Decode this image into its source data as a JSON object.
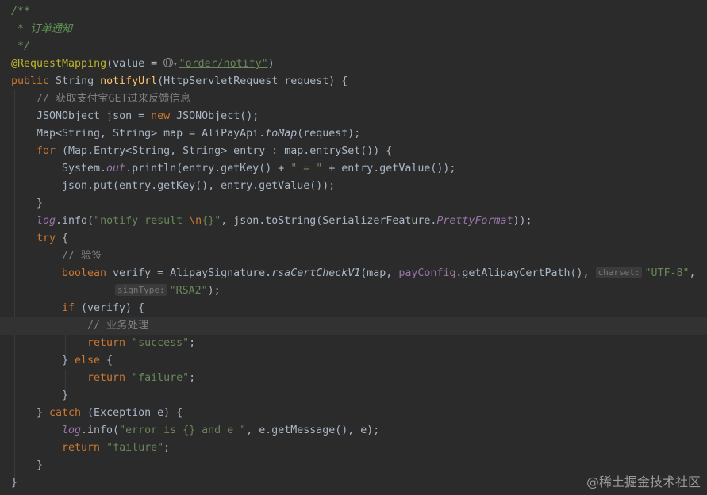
{
  "comment": {
    "open": "/**",
    "body": " * 订单通知",
    "close": " */"
  },
  "annotation": {
    "name": "@RequestMapping",
    "open": "(value = ",
    "value": "\"order/notify\"",
    "close": ")"
  },
  "method": {
    "mod1": "public",
    "rest1": " String ",
    "name": "notifyUrl",
    "params": "(HttpServletRequest request) {"
  },
  "lines": {
    "l6_comment": "// 获取支付宝GET过来反馈信息",
    "l7_a": "JSONObject json = ",
    "l7_kw": "new",
    "l7_b": " JSONObject();",
    "l8_a": "Map<String, String> map = AliPayApi.",
    "l8_m": "toMap",
    "l8_b": "(request);",
    "l9_kw": "for",
    "l9_b": " (Map.Entry<String, String> entry : map.entrySet()) {",
    "l10_a": "System.",
    "l10_out": "out",
    "l10_b": ".println(entry.getKey() + ",
    "l10_str": "\" = \"",
    "l10_c": " + entry.getValue());",
    "l11": "json.put(entry.getKey(), entry.getValue());",
    "l12": "}",
    "l13_log": "log",
    "l13_a": ".info(",
    "l13_s1": "\"notify result ",
    "l13_esc": "\\n",
    "l13_s2": "{}\"",
    "l13_b": ", json.toString(SerializerFeature.",
    "l13_pf": "PrettyFormat",
    "l13_c": "));",
    "l14_kw": "try",
    "l14_b": " {",
    "l15_comment": "// 验签",
    "l16_kw": "boolean",
    "l16_a": " verify = AlipaySignature.",
    "l16_m": "rsaCertCheckV1",
    "l16_b": "(map, ",
    "l16_field": "payConfig",
    "l16_c": ".getAlipayCertPath(), ",
    "l16_hint": "charset:",
    "l16_str": "\"UTF-8\"",
    "l16_d": ",",
    "l17_hint": "signType:",
    "l17_str": "\"RSA2\"",
    "l17_b": ");",
    "l18_kw": "if",
    "l18_b": " (verify) {",
    "l19_comment": "// 业务处理",
    "l20_kw": "return",
    "l20_str": "\"success\"",
    "l20_b": ";",
    "l21_a": "} ",
    "l21_kw": "else",
    "l21_b": " {",
    "l22_kw": "return",
    "l22_str": "\"failure\"",
    "l22_b": ";",
    "l23": "}",
    "l24_a": "} ",
    "l24_kw": "catch",
    "l24_b": " (Exception e) {",
    "l25_log": "log",
    "l25_a": ".info(",
    "l25_str": "\"error is {} and e \"",
    "l25_b": ", e.getMessage(), e);",
    "l26_kw": "return",
    "l26_str": "\"failure\"",
    "l26_b": ";",
    "l27": "}",
    "l28": "}"
  },
  "watermark": "@稀土掘金技术社区",
  "colors": {
    "background": "#2b2b2b",
    "current_line": "#323232",
    "keyword": "#cc7832",
    "string": "#6a8759",
    "annotation": "#bbb529",
    "method_decl": "#ffc66d",
    "field": "#9876aa",
    "comment": "#808080",
    "doc_comment": "#629755",
    "text": "#a9b7c6"
  }
}
